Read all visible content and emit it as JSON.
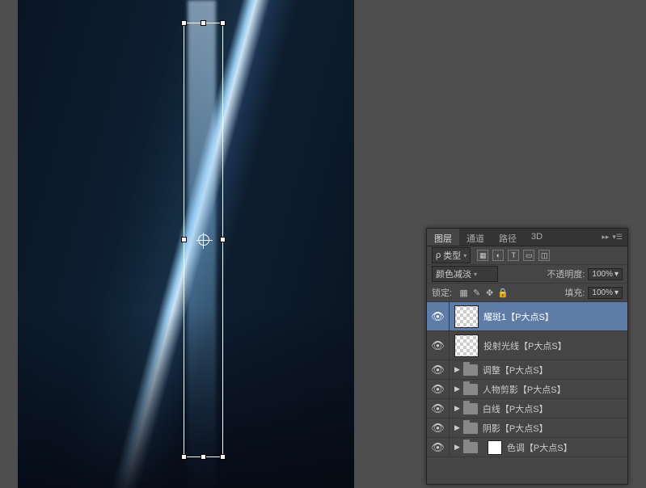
{
  "tabs": {
    "layers": "图层",
    "channels": "通道",
    "paths": "路径",
    "threed": "3D"
  },
  "kind_dropdown": "类型",
  "blend_mode": "颜色减淡",
  "opacity_label": "不透明度:",
  "opacity_value": "100%",
  "lock_label": "锁定:",
  "fill_label": "填充:",
  "fill_value": "100%",
  "filter_icons": {
    "image": "▦",
    "adjust": "◐",
    "type": "T",
    "shape": "▭",
    "smart": "◫"
  },
  "lock_icons": {
    "trans": "▦",
    "paint": "✎",
    "move": "✥",
    "all": "🔒"
  },
  "layers": [
    {
      "type": "pixel",
      "name": "耀斑1【P大点S】",
      "selected": true,
      "thumb": "checker"
    },
    {
      "type": "pixel",
      "name": "投射光线【P大点S】",
      "selected": false,
      "thumb": "checker"
    },
    {
      "type": "group",
      "name": "调整【P大点S】"
    },
    {
      "type": "group",
      "name": "人物剪影【P大点S】"
    },
    {
      "type": "group",
      "name": "白线【P大点S】"
    },
    {
      "type": "group",
      "name": "阴影【P大点S】"
    },
    {
      "type": "group",
      "name": "色调【P大点S】",
      "hasThumb": true
    }
  ]
}
